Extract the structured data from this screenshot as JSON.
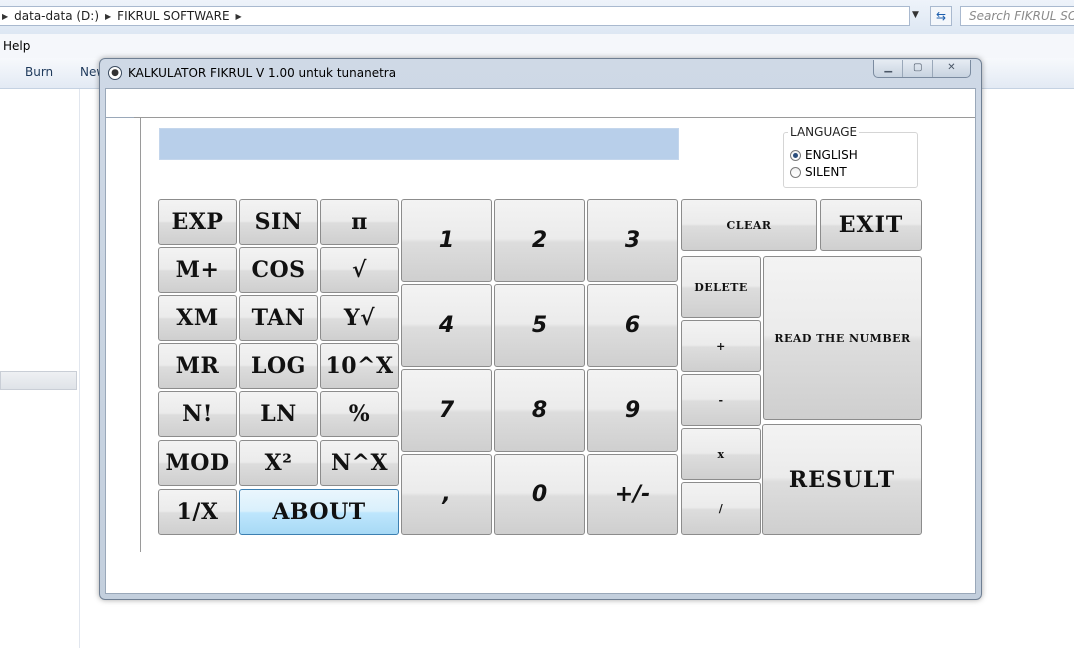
{
  "explorer": {
    "breadcrumbs": [
      "data-data (D:)",
      "FIKRUL SOFTWARE"
    ],
    "search_placeholder": "Search FIKRUL SOFTWARE",
    "menu_help": "Help",
    "cmd_burn": "Burn",
    "cmd_new": "New"
  },
  "calculator": {
    "title": "KALKULATOR FIKRUL V 1.00 untuk tunanetra",
    "display_value": "",
    "language": {
      "legend": "LANGUAGE",
      "options": [
        "ENGLISH",
        "SILENT"
      ],
      "selected": "ENGLISH"
    },
    "func_buttons": {
      "exp": "EXP",
      "sin": "SIN",
      "pi": "π",
      "mplus": "M+",
      "cos": "COS",
      "sqrt": "√",
      "xm": "XM",
      "tan": "TAN",
      "yroot": "Y√",
      "mr": "MR",
      "log": "LOG",
      "tenpow": "10^X",
      "fact": "N!",
      "ln": "LN",
      "percent": "%",
      "mod": "MOD",
      "square": "X²",
      "npow": "N^X",
      "inverse": "1/X",
      "about": "ABOUT"
    },
    "num_buttons": {
      "one": "1",
      "two": "2",
      "three": "3",
      "four": "4",
      "five": "5",
      "six": "6",
      "seven": "7",
      "eight": "8",
      "nine": "9",
      "comma": ",",
      "zero": "0",
      "sign": "+/-"
    },
    "op_buttons": {
      "clear": "CLEAR",
      "exit": "EXIT",
      "delete": "DELETE",
      "read": "READ THE NUMBER",
      "plus": "+",
      "minus": "-",
      "times": "x",
      "divide": "/",
      "result": "RESULT"
    }
  }
}
